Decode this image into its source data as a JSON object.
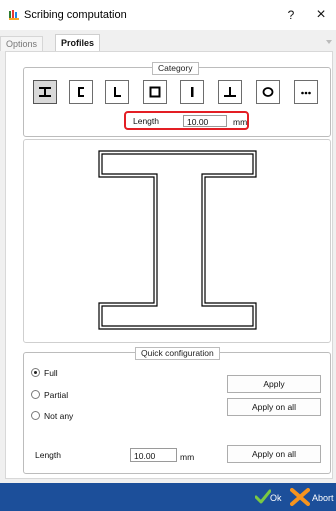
{
  "window": {
    "title": "Scribing computation",
    "help_label": "?",
    "close_label": "×"
  },
  "tabs": [
    {
      "label": "Options"
    },
    {
      "label": "Profiles"
    }
  ],
  "category": {
    "legend": "Category",
    "buttons": [
      {
        "icon": "i-profile-icon",
        "selected": true
      },
      {
        "icon": "u-channel-profile-icon"
      },
      {
        "icon": "l-angle-profile-icon"
      },
      {
        "icon": "square-tube-profile-icon"
      },
      {
        "icon": "flat-bar-profile-icon"
      },
      {
        "icon": "t-profile-icon"
      },
      {
        "icon": "round-tube-profile-icon"
      },
      {
        "icon": "more-profiles-icon"
      }
    ],
    "length_label": "Length",
    "length_value": "10.00",
    "length_unit": "mm"
  },
  "quick_config": {
    "legend": "Quick configuration",
    "options": [
      {
        "label": "Full",
        "checked": true
      },
      {
        "label": "Partial",
        "checked": false
      },
      {
        "label": "Not any",
        "checked": false
      }
    ],
    "apply_label": "Apply",
    "apply_all_label": "Apply on all",
    "length_label": "Length",
    "length_value": "10.00",
    "length_unit": "mm",
    "length_apply_all_label": "Apply on all"
  },
  "footer": {
    "ok_label": "Ok",
    "abort_label": "Abort"
  },
  "colors": {
    "footer_bg": "#1c4f9a",
    "highlight": "#e31e24",
    "ok_icon": "#7ac943",
    "abort_icon": "#f7941d"
  }
}
